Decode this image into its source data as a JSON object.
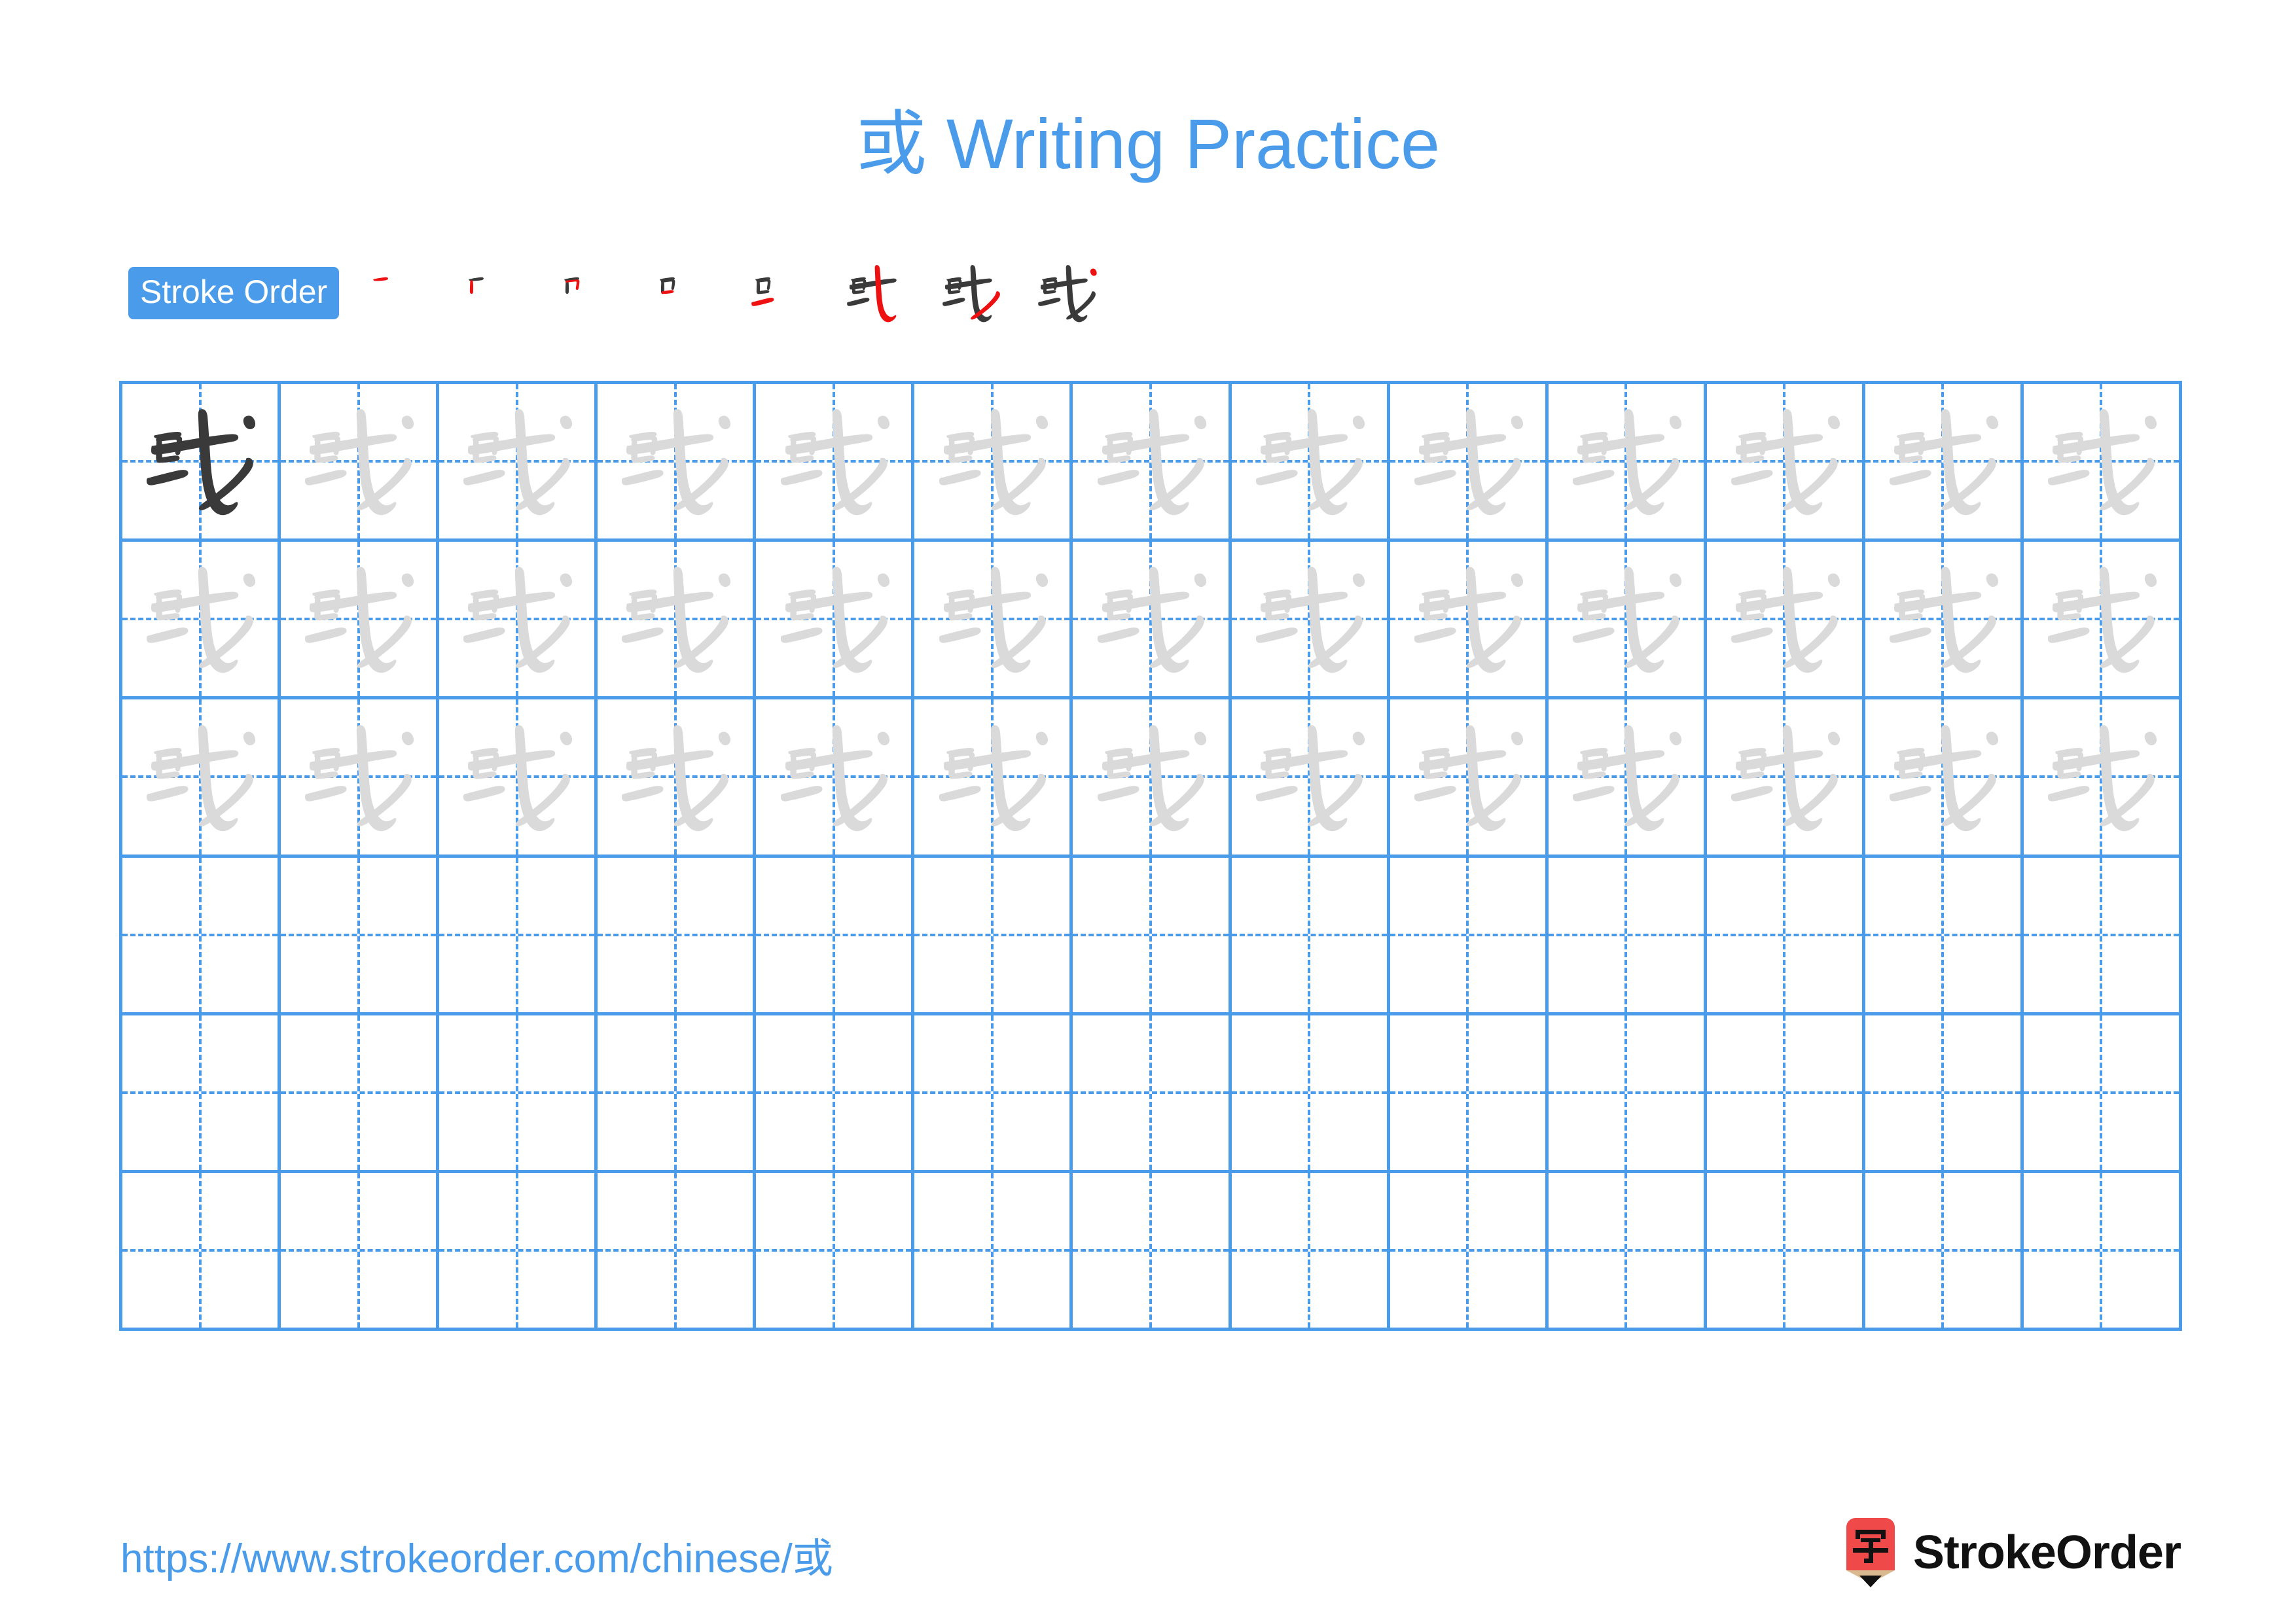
{
  "page": {
    "title_character": "或",
    "title_suffix": " Writing Practice",
    "accent_color": "#4a9ceb",
    "trace_color": "#dadada",
    "model_color": "#3a3a3a",
    "new_stroke_color": "#ee1111"
  },
  "stroke_order": {
    "badge_label": "Stroke Order",
    "total_strokes": 8,
    "steps": [
      {
        "step": 1,
        "strokes_drawn": 1
      },
      {
        "step": 2,
        "strokes_drawn": 2
      },
      {
        "step": 3,
        "strokes_drawn": 3
      },
      {
        "step": 4,
        "strokes_drawn": 4
      },
      {
        "step": 5,
        "strokes_drawn": 5
      },
      {
        "step": 6,
        "strokes_drawn": 6
      },
      {
        "step": 7,
        "strokes_drawn": 7
      },
      {
        "step": 8,
        "strokes_drawn": 8
      }
    ]
  },
  "practice_grid": {
    "columns": 13,
    "rows": 6,
    "rows_data": [
      {
        "row": 1,
        "cells": [
          "model",
          "trace",
          "trace",
          "trace",
          "trace",
          "trace",
          "trace",
          "trace",
          "trace",
          "trace",
          "trace",
          "trace",
          "trace"
        ]
      },
      {
        "row": 2,
        "cells": [
          "trace",
          "trace",
          "trace",
          "trace",
          "trace",
          "trace",
          "trace",
          "trace",
          "trace",
          "trace",
          "trace",
          "trace",
          "trace"
        ]
      },
      {
        "row": 3,
        "cells": [
          "trace",
          "trace",
          "trace",
          "trace",
          "trace",
          "trace",
          "trace",
          "trace",
          "trace",
          "trace",
          "trace",
          "trace",
          "trace"
        ]
      },
      {
        "row": 4,
        "cells": [
          "empty",
          "empty",
          "empty",
          "empty",
          "empty",
          "empty",
          "empty",
          "empty",
          "empty",
          "empty",
          "empty",
          "empty",
          "empty"
        ]
      },
      {
        "row": 5,
        "cells": [
          "empty",
          "empty",
          "empty",
          "empty",
          "empty",
          "empty",
          "empty",
          "empty",
          "empty",
          "empty",
          "empty",
          "empty",
          "empty"
        ]
      },
      {
        "row": 6,
        "cells": [
          "empty",
          "empty",
          "empty",
          "empty",
          "empty",
          "empty",
          "empty",
          "empty",
          "empty",
          "empty",
          "empty",
          "empty",
          "empty"
        ]
      }
    ]
  },
  "footer": {
    "url": "https://www.strokeorder.com/chinese/或",
    "brand_name": "StrokeOrder",
    "logo_character": "字",
    "logo_body_color": "#f0494a",
    "logo_wood_color": "#d9b98f",
    "logo_tip_color": "#111111"
  }
}
